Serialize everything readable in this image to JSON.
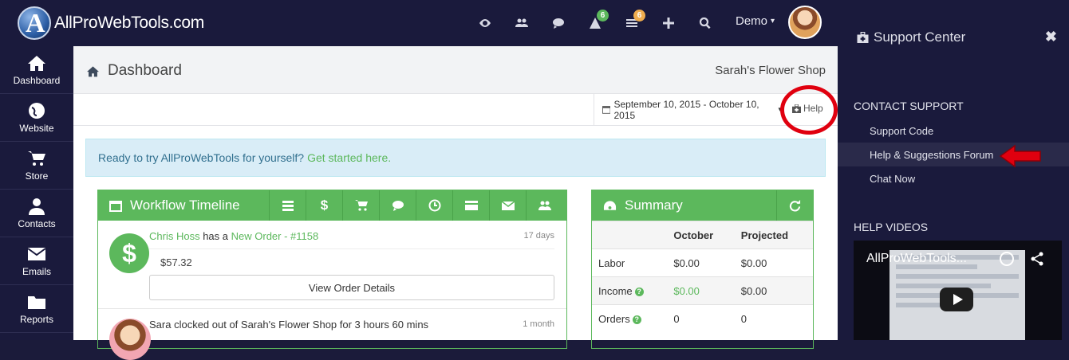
{
  "app": {
    "logo_text": "AllProWebTools.com"
  },
  "topbar": {
    "icons": [
      {
        "name": "eye-icon"
      },
      {
        "name": "users-icon"
      },
      {
        "name": "comments-icon"
      },
      {
        "name": "alert-icon",
        "badge": "6"
      },
      {
        "name": "tasks-icon",
        "badge": "6"
      },
      {
        "name": "plus-icon"
      },
      {
        "name": "search-icon"
      }
    ],
    "user_label": "Demo"
  },
  "sidebar": {
    "items": [
      {
        "label": "Dashboard",
        "icon": "home-icon"
      },
      {
        "label": "Website",
        "icon": "globe-icon"
      },
      {
        "label": "Store",
        "icon": "cart-icon"
      },
      {
        "label": "Contacts",
        "icon": "user-icon"
      },
      {
        "label": "Emails",
        "icon": "envelope-icon"
      },
      {
        "label": "Reports",
        "icon": "folder-icon"
      }
    ]
  },
  "main": {
    "title": "Dashboard",
    "shop_name": "Sarah's Flower Shop",
    "date_range": "September 10, 2015 - October 10, 2015",
    "help_label": "Help",
    "alert_text": "Ready to try AllProWebTools for yourself?",
    "alert_link": "Get started here."
  },
  "workflow": {
    "title": "Workflow Timeline",
    "item1": {
      "actor": "Chris Hoss",
      "verb": "has a",
      "object": "New Order - #1158",
      "time": "17 days",
      "amount": "$57.32",
      "button": "View Order Details"
    },
    "item2": {
      "text": "Sara clocked out of Sarah's Flower Shop for 3 hours 60 mins",
      "time": "1 month"
    }
  },
  "summary": {
    "title": "Summary",
    "columns": [
      "October",
      "Projected"
    ],
    "rows": [
      {
        "label": "Labor",
        "october": "$0.00",
        "projected": "$0.00"
      },
      {
        "label": "Income",
        "october": "$0.00",
        "projected": "$0.00"
      },
      {
        "label": "Orders",
        "october": "0",
        "projected": "0"
      }
    ]
  },
  "support": {
    "title": "Support Center",
    "close": "✖",
    "contact_heading": "CONTACT SUPPORT",
    "links": [
      "Support Code",
      "Help & Suggestions Forum",
      "Chat Now"
    ],
    "videos_heading": "HELP VIDEOS",
    "video_title": "AllProWebTools..."
  },
  "colors": {
    "brand_green": "#5cb85c",
    "nav_bg": "#1a1a3c",
    "highlight_red": "#e0000f"
  }
}
